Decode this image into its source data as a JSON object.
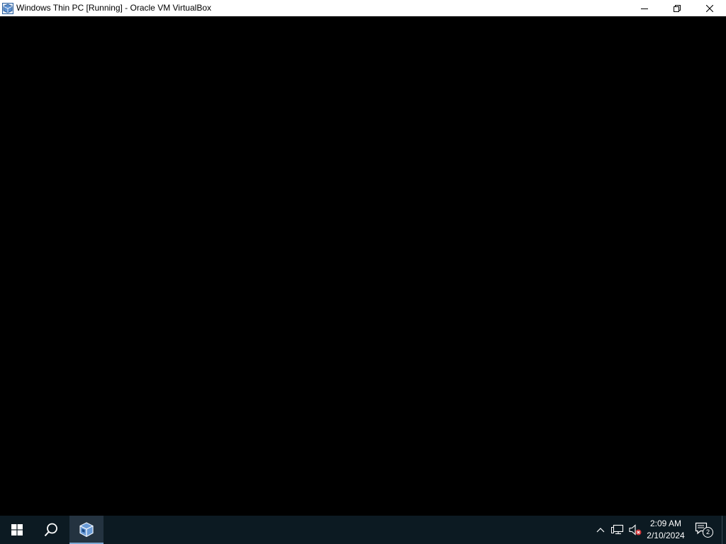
{
  "window": {
    "title": "Windows Thin PC [Running] - Oracle VM VirtualBox",
    "app_icon": "virtualbox-icon",
    "controls": {
      "minimize": "minimize-icon",
      "restore": "restore-icon",
      "close": "close-icon"
    }
  },
  "taskbar": {
    "start_icon": "windows-logo-icon",
    "search_icon": "search-icon",
    "pinned": [
      {
        "icon": "virtualbox-icon",
        "active": true
      }
    ],
    "tray": {
      "chevron_icon": "chevron-up-icon",
      "network_icon": "network-icon",
      "volume_icon": "volume-muted-icon",
      "time": "2:09 AM",
      "date": "2/10/2024",
      "notifications_count": "2"
    }
  },
  "colors": {
    "vm_background": "#000000",
    "taskbar_background": "#0c1a22",
    "titlebar_background": "#ffffff",
    "active_indicator": "#7aa8d2"
  }
}
